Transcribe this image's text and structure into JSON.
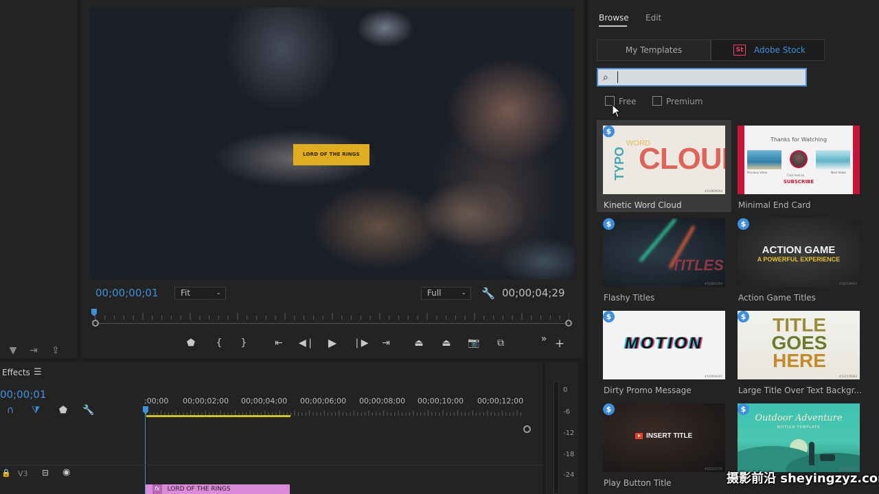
{
  "program_monitor": {
    "title_overlay": "LORD OF THE RINGS",
    "timecode_current": "00;00;00;01",
    "timecode_duration": "00;00;04;29",
    "zoom": "Fit",
    "resolution": "Full"
  },
  "timeline": {
    "panel_label": "Effects",
    "timecode": "00;00;01",
    "ruler": [
      ";00;00",
      "00;00;02;00",
      "00;00;04;00",
      "00;00;06;00",
      "00;00;08;00",
      "00;00;10;00",
      "00;00;12;00"
    ],
    "track_v3": "V3",
    "clip_fx": "fx",
    "clip_label": "LORD OF THE RINGS"
  },
  "audio_meter": {
    "labels": [
      "0",
      "-6",
      "-12",
      "-18",
      "-24"
    ]
  },
  "essential_graphics": {
    "tabs": {
      "browse": "Browse",
      "edit": "Edit"
    },
    "segments": {
      "templates": "My Templates",
      "stock": "Adobe Stock",
      "stock_logo": "St"
    },
    "search": {
      "value": "",
      "placeholder": ""
    },
    "filters": {
      "free": "Free",
      "premium": "Premium"
    },
    "templates": [
      {
        "name": "Kinetic Word Cloud",
        "paid": true,
        "selected": true,
        "thumb_text": [
          "CLOUD",
          "TYPO",
          "WORD",
          "#319899204"
        ]
      },
      {
        "name": "Minimal End Card",
        "paid": false,
        "thumb_text": [
          "Thanks for Watching",
          "Previous Video",
          "Click here to",
          "SUBSCRIBE",
          "Next Video"
        ]
      },
      {
        "name": "Flashy Titles",
        "paid": true,
        "thumb_text": [
          "TITLES",
          "#320662459"
        ]
      },
      {
        "name": "Action Game Titles",
        "paid": false,
        "thumb_text": [
          "ACTION GAME",
          "A POWERFUL EXPERIENCE",
          "#320539996"
        ]
      },
      {
        "name": "Dirty Promo Message",
        "paid": true,
        "thumb_text": [
          "MOTION",
          "#319699405"
        ]
      },
      {
        "name": "Large Title Over Text Backgr...",
        "paid": true,
        "thumb_text": [
          "TITLE",
          "GOES",
          "HERE",
          "#321576683"
        ]
      },
      {
        "name": "Play Button Title",
        "paid": true,
        "thumb_text": [
          "INSERT TITLE",
          "#321521776"
        ]
      },
      {
        "name": "",
        "paid": true,
        "thumb_text": [
          "Outdoor Adventure",
          "MOTION TEMPLATE",
          "#321505637"
        ]
      }
    ]
  },
  "watermark": "摄影前沿 sheyingzyz.com",
  "colors": {
    "accent": "#3f8fdc",
    "title_bg": "#e0ad1f",
    "clip": "#d98ad8",
    "stock": "#f03e6a"
  }
}
